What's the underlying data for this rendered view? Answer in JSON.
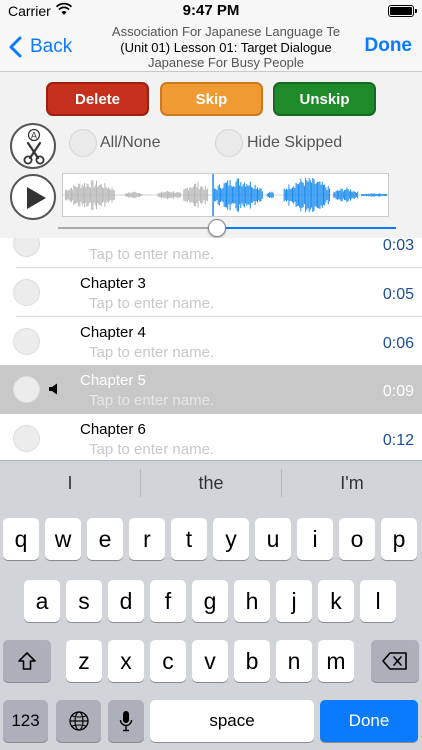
{
  "status_bar": {
    "carrier": "Carrier",
    "time": "9:47 PM"
  },
  "nav": {
    "back_label": "Back",
    "title_line1": "Association For Japanese Language Te",
    "title_line2": "(Unit 01) Lesson 01: Target Dialogue",
    "title_line3": "Japanese For Busy People",
    "done_label": "Done"
  },
  "actions": {
    "delete_label": "Delete",
    "skip_label": "Skip",
    "unskip_label": "Unskip",
    "colors": {
      "delete": "#c4301b",
      "skip": "#f09a34",
      "unskip": "#1f8a2a"
    }
  },
  "options": {
    "all_none_label": "All/None",
    "hide_skipped_label": "Hide Skipped"
  },
  "player": {
    "scissors_icon": "scissors-icon",
    "play_icon": "play-icon",
    "progress_fraction": 0.47
  },
  "chapters": [
    {
      "title": "",
      "placeholder": "Tap to enter name.",
      "duration": "0:03",
      "selected": false
    },
    {
      "title": "Chapter 3",
      "placeholder": "Tap to enter name.",
      "duration": "0:05",
      "selected": false
    },
    {
      "title": "Chapter 4",
      "placeholder": "Tap to enter name.",
      "duration": "0:06",
      "selected": false
    },
    {
      "title": "Chapter 5",
      "placeholder": "Tap to enter name.",
      "duration": "0:09",
      "selected": true
    },
    {
      "title": "Chapter 6",
      "placeholder": "Tap to enter name.",
      "duration": "0:12",
      "selected": false
    }
  ],
  "keyboard": {
    "suggestions": [
      "I",
      "the",
      "I'm"
    ],
    "row1": [
      "q",
      "w",
      "e",
      "r",
      "t",
      "y",
      "u",
      "i",
      "o",
      "p"
    ],
    "row2": [
      "a",
      "s",
      "d",
      "f",
      "g",
      "h",
      "j",
      "k",
      "l"
    ],
    "row3": [
      "z",
      "x",
      "c",
      "v",
      "b",
      "n",
      "m"
    ],
    "numbers_label": "123",
    "space_label": "space",
    "done_label": "Done"
  },
  "colors": {
    "accent": "#0a7bff",
    "duration": "#1b4f9b",
    "waveform_active": "#1a8cf0",
    "waveform_inactive": "#b8b8b8"
  }
}
